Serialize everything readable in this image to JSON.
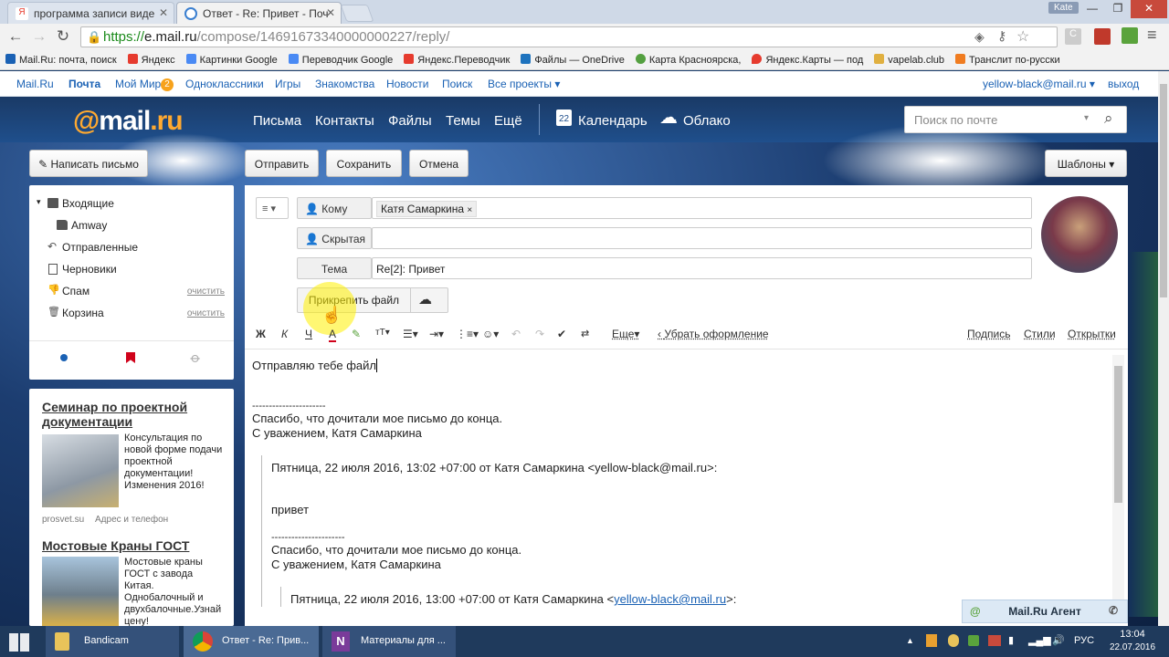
{
  "browser": {
    "tabs": [
      {
        "label": "программа записи виде"
      },
      {
        "label": "Ответ - Re: Привет - Поч"
      }
    ],
    "profile": "Kate",
    "url_scheme": "https://",
    "url_host": "e.mail.ru",
    "url_path": "/compose/14691673340000000227/reply/",
    "bookmarks": [
      {
        "label": "Mail.Ru: почта, поиск",
        "color": "#1a61b4"
      },
      {
        "label": "Яндекс",
        "color": "#e63b2e"
      },
      {
        "label": "Картинки Google",
        "color": "#4a8af4"
      },
      {
        "label": "Переводчик Google",
        "color": "#4a8af4"
      },
      {
        "label": "Яндекс.Переводчик",
        "color": "#e63b2e"
      },
      {
        "label": "Файлы — OneDrive",
        "color": "#1e73be"
      },
      {
        "label": "Карта Красноярска,",
        "color": "#54a040"
      },
      {
        "label": "Яндекс.Карты — под",
        "color": "#e63b2e"
      },
      {
        "label": "vapelab.club",
        "color": "#e0b040"
      },
      {
        "label": "Транслит по-русски",
        "color": "#f07c20"
      }
    ]
  },
  "portal": {
    "links": [
      "Mail.Ru",
      "Почта",
      "Мой Мир",
      "Одноклассники",
      "Игры",
      "Знакомства",
      "Новости",
      "Поиск",
      "Все проекты"
    ],
    "moi_mir_badge": "2",
    "user_email": "yellow-black@mail.ru",
    "logout": "выход"
  },
  "header": {
    "logo_at": "@",
    "logo_mail": "mail",
    "logo_ru": ".ru",
    "nav": [
      "Письма",
      "Контакты",
      "Файлы",
      "Темы",
      "Ещё"
    ],
    "calendar": "Календарь",
    "calendar_day": "22",
    "cloud": "Облако",
    "search_placeholder": "Поиск по почте"
  },
  "actions": {
    "compose": "Написать письмо",
    "send": "Отправить",
    "save": "Сохранить",
    "cancel": "Отмена",
    "templates": "Шаблоны"
  },
  "folders": [
    {
      "label": "Входящие",
      "clean": ""
    },
    {
      "label": "Amway",
      "clean": ""
    },
    {
      "label": "Отправленные",
      "clean": ""
    },
    {
      "label": "Черновики",
      "clean": ""
    },
    {
      "label": "Спам",
      "clean": "очистить"
    },
    {
      "label": "Корзина",
      "clean": "очистить"
    }
  ],
  "ads": [
    {
      "title": "Семинар по проектной документации",
      "text": "Консультация по новой форме подачи проектной документации! Изменения 2016!",
      "source": "prosvet.su",
      "extra": "Адрес и телефон"
    },
    {
      "title": "Мостовые Краны ГОСТ",
      "text": "Мостовые краны ГОСТ с завода Китая. Однобалочный и двухбалочные.Узнай цену!"
    }
  ],
  "compose": {
    "to_label": "Кому",
    "to_value": "Катя Самаркина",
    "bcc_label": "Скрытая",
    "subject_label": "Тема",
    "subject_value": "Re[2]: Привет",
    "attach": "Прикрепить файл",
    "toolbar_more": "Еще",
    "toolbar_clear": "Убрать оформление",
    "signature": "Подпись",
    "styles": "Стили",
    "cards": "Открытки"
  },
  "body": {
    "line1": "Отправляю тебе файл",
    "sep": "----------------------",
    "thanks": "Спасибо, что дочитали мое письмо до конца.",
    "regards": "С уважением, Катя Самаркина",
    "quote1_header": "Пятница, 22 июля 2016, 13:02 +07:00 от Катя Самаркина <yellow-black@mail.ru>:",
    "quote1_text": "привет",
    "quote1_sep": "----------------------",
    "quote1_thanks": "Спасибо, что дочитали мое письмо до конца.",
    "quote1_regards": "С уважением, Катя Самаркина",
    "quote2_header_prefix": "Пятница, 22 июля 2016, 13:00 +07:00 от Катя Самаркина <",
    "quote2_email": "yellow-black@mail.ru",
    "quote2_header_suffix": ">:"
  },
  "agent": {
    "label": "Mail.Ru Агент"
  },
  "taskbar": {
    "items": [
      "Bandicam",
      "Ответ - Re: Прив...",
      "Материалы для ..."
    ],
    "lang": "РУС",
    "time": "13:04",
    "date": "22.07.2016"
  },
  "colors": {
    "accent": "#1a61b4",
    "logo_orange": "#ffa930",
    "header_bg": "#1f4f8c"
  }
}
